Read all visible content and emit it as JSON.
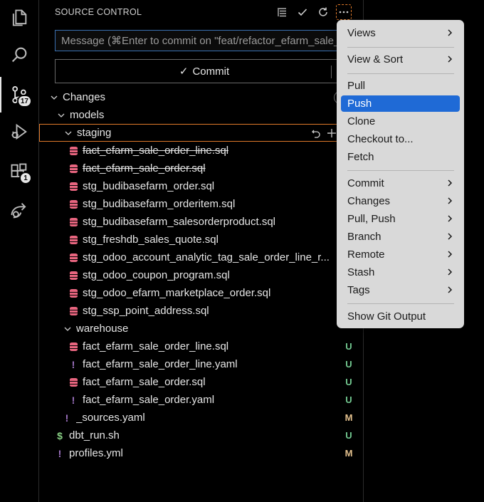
{
  "activity_bar": {
    "items": [
      {
        "name": "explorer",
        "icon": "files-icon",
        "badge": ""
      },
      {
        "name": "search",
        "icon": "search-icon",
        "badge": ""
      },
      {
        "name": "source-control",
        "icon": "source-control-icon",
        "badge": "17"
      },
      {
        "name": "run-debug",
        "icon": "debug-icon",
        "badge": ""
      },
      {
        "name": "extensions",
        "icon": "extensions-icon",
        "badge": "1"
      },
      {
        "name": "remote",
        "icon": "remote-icon",
        "badge": ""
      }
    ]
  },
  "source_control": {
    "title": "SOURCE CONTROL",
    "message_placeholder": "Message (⌘Enter to commit on \"feat/refactor_efarm_sale_order\")",
    "commit_label": "Commit",
    "changes_label": "Changes"
  },
  "tree": {
    "models": "models",
    "staging": "staging",
    "warehouse": "warehouse",
    "staging_files": [
      {
        "name": "fact_efarm_sale_order_line.sql",
        "deleted": true
      },
      {
        "name": "fact_efarm_sale_order.sql",
        "deleted": true
      },
      {
        "name": "stg_budibasefarm_order.sql",
        "deleted": false
      },
      {
        "name": "stg_budibasefarm_orderitem.sql",
        "deleted": false
      },
      {
        "name": "stg_budibasefarm_salesorderproduct.sql",
        "deleted": false
      },
      {
        "name": "stg_freshdb_sales_quote.sql",
        "deleted": false
      },
      {
        "name": "stg_odoo_account_analytic_tag_sale_order_line_r...",
        "deleted": false
      },
      {
        "name": "stg_odoo_coupon_program.sql",
        "deleted": false
      },
      {
        "name": "stg_odoo_efarm_marketplace_order.sql",
        "deleted": false
      },
      {
        "name": "stg_ssp_point_address.sql",
        "deleted": false
      }
    ],
    "warehouse_files": [
      {
        "name": "fact_efarm_sale_order_line.sql",
        "type": "sql",
        "status": "U"
      },
      {
        "name": "fact_efarm_sale_order_line.yaml",
        "type": "yaml",
        "status": "U"
      },
      {
        "name": "fact_efarm_sale_order.sql",
        "type": "sql",
        "status": "U"
      },
      {
        "name": "fact_efarm_sale_order.yaml",
        "type": "yaml",
        "status": "U"
      }
    ],
    "model_files": [
      {
        "name": "_sources.yaml",
        "type": "yaml",
        "status": "M"
      }
    ],
    "root_files": [
      {
        "name": "dbt_run.sh",
        "type": "sh",
        "status": "U"
      },
      {
        "name": "profiles.yml",
        "type": "yaml",
        "status": "M"
      }
    ]
  },
  "menu": {
    "items": [
      {
        "label": "Views",
        "submenu": true
      },
      {
        "label": "View & Sort",
        "submenu": true
      },
      {
        "label": "Pull",
        "submenu": false
      },
      {
        "label": "Push",
        "submenu": false
      },
      {
        "label": "Clone",
        "submenu": false
      },
      {
        "label": "Checkout to...",
        "submenu": false
      },
      {
        "label": "Fetch",
        "submenu": false
      },
      {
        "label": "Commit",
        "submenu": true
      },
      {
        "label": "Changes",
        "submenu": true
      },
      {
        "label": "Pull, Push",
        "submenu": true
      },
      {
        "label": "Branch",
        "submenu": true
      },
      {
        "label": "Remote",
        "submenu": true
      },
      {
        "label": "Stash",
        "submenu": true
      },
      {
        "label": "Tags",
        "submenu": true
      },
      {
        "label": "Show Git Output",
        "submenu": false
      }
    ],
    "active": "Push"
  },
  "colors": {
    "untracked": "#73c991",
    "modified": "#e2c08d",
    "sql_icon": "#e8657f",
    "yaml_icon": "#a074c4",
    "sh_icon": "#89d185",
    "menu_highlight": "#1f6ad6",
    "focus_border": "#e07a2a"
  }
}
